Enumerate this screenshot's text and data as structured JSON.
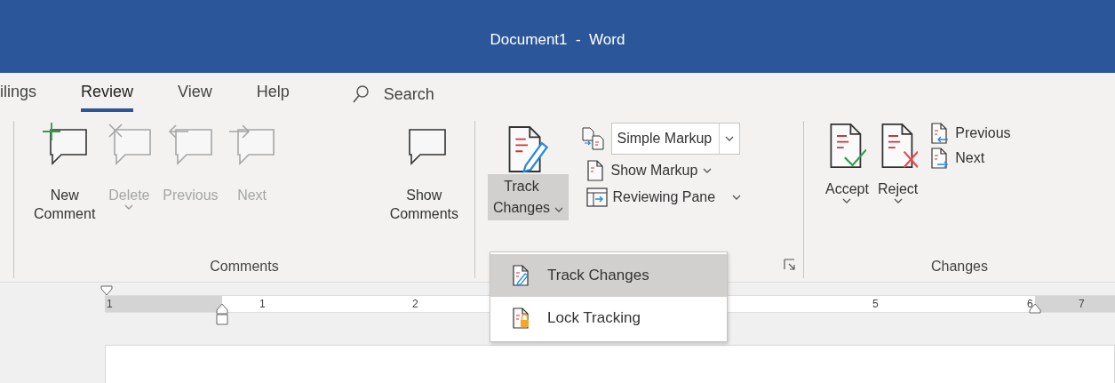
{
  "window": {
    "title": "Document1  -  Word"
  },
  "tabs": [
    {
      "label": "ilings",
      "selected": false
    },
    {
      "label": "Review",
      "selected": true
    },
    {
      "label": "View",
      "selected": false
    },
    {
      "label": "Help",
      "selected": false
    }
  ],
  "search": {
    "label": "Search"
  },
  "comments_group": {
    "name": "Comments",
    "buttons": [
      {
        "label": "New Comment",
        "disabled": false,
        "dropdown": false
      },
      {
        "label": "Delete",
        "disabled": true,
        "dropdown": true
      },
      {
        "label": "Previous",
        "disabled": true,
        "dropdown": false
      },
      {
        "label": "Next",
        "disabled": true,
        "dropdown": false
      },
      {
        "label": "Show Comments",
        "disabled": false,
        "dropdown": false
      }
    ]
  },
  "tracking_group": {
    "track_button": {
      "label": "Track Changes",
      "pressed": true
    },
    "markup_combo": {
      "value": "Simple Markup"
    },
    "items": [
      {
        "label": "Show Markup"
      },
      {
        "label": "Reviewing Pane"
      }
    ]
  },
  "changes_group": {
    "name": "Changes",
    "big_buttons": [
      {
        "label": "Accept"
      },
      {
        "label": "Reject"
      }
    ],
    "small_buttons": [
      {
        "label": "Previous"
      },
      {
        "label": "Next"
      }
    ]
  },
  "ruler": {
    "labels": [
      "1",
      "1",
      "2",
      "5",
      "6",
      "7"
    ]
  },
  "track_menu": {
    "items": [
      {
        "label": "Track Changes",
        "selected": true
      },
      {
        "label": "Lock Tracking",
        "selected": false
      }
    ]
  }
}
